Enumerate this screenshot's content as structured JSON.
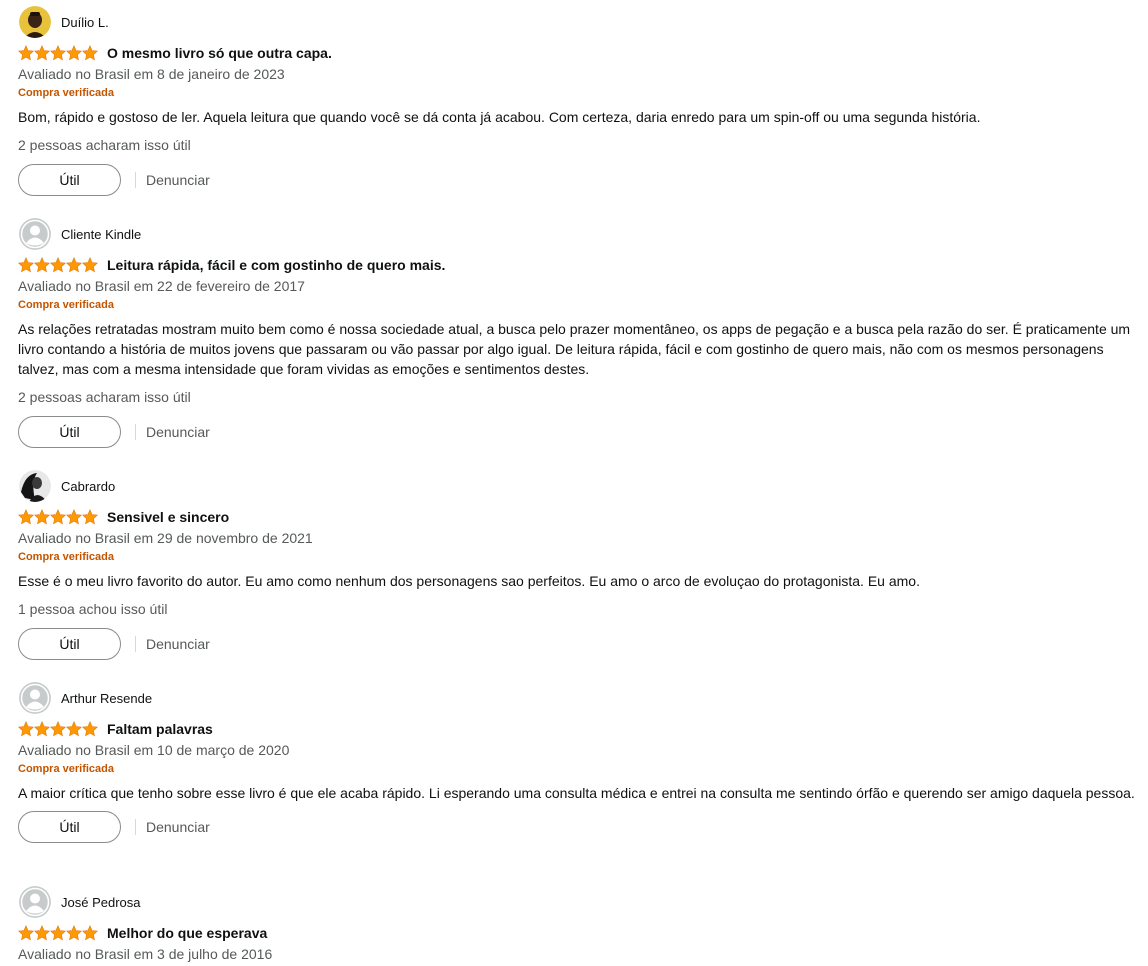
{
  "reviews": [
    {
      "reviewer": "Duílio L.",
      "avatar_icon": "user-photo-avatar",
      "rating": 5,
      "title": "O mesmo livro só que outra capa.",
      "date": "Avaliado no Brasil em 8 de janeiro de 2023",
      "verified": "Compra verificada",
      "body": "Bom, rápido e gostoso de ler. Aquela leitura que quando você se dá conta já acabou. Com certeza, daria enredo para um spin-off ou uma segunda história.",
      "helpful": "2 pessoas acharam isso útil",
      "useful_label": "Útil",
      "report_label": "Denunciar"
    },
    {
      "reviewer": "Cliente Kindle",
      "avatar_icon": "default-user-avatar",
      "rating": 5,
      "title": "Leitura rápida, fácil e com gostinho de quero mais.",
      "date": "Avaliado no Brasil em 22 de fevereiro de 2017",
      "verified": "Compra verificada",
      "body": "As relações retratadas mostram muito bem como é nossa sociedade atual, a busca pelo prazer momentâneo, os apps de pegação e a busca pela razão do ser. É praticamente um livro contando a história de muitos jovens que passaram ou vão passar por algo igual. De leitura rápida, fácil e com gostinho de quero mais, não com os mesmos personagens talvez, mas com a mesma intensidade que foram vividas as emoções e sentimentos destes.",
      "helpful": "2 pessoas acharam isso útil",
      "useful_label": "Útil",
      "report_label": "Denunciar"
    },
    {
      "reviewer": "Cabrardo",
      "avatar_icon": "user-photo-avatar",
      "rating": 5,
      "title": "Sensivel e sincero",
      "date": "Avaliado no Brasil em 29 de novembro de 2021",
      "verified": "Compra verificada",
      "body": "Esse é o meu livro favorito do autor. Eu amo como nenhum dos personagens sao perfeitos. Eu amo o arco de evoluçao do protagonista. Eu amo.",
      "helpful": "1 pessoa achou isso útil",
      "useful_label": "Útil",
      "report_label": "Denunciar"
    },
    {
      "reviewer": "Arthur Resende",
      "avatar_icon": "default-user-avatar",
      "rating": 5,
      "title": "Faltam palavras",
      "date": "Avaliado no Brasil em 10 de março de 2020",
      "verified": "Compra verificada",
      "body": "A maior crítica que tenho sobre esse livro é que ele acaba rápido. Li esperando uma consulta médica e entrei na consulta me sentindo órfão e querendo ser amigo daquela pessoa.",
      "useful_label": "Útil",
      "report_label": "Denunciar"
    },
    {
      "reviewer": "José Pedrosa",
      "avatar_icon": "default-user-avatar",
      "rating": 5,
      "title": "Melhor do que esperava",
      "date": "Avaliado no Brasil em 3 de julho de 2016"
    }
  ],
  "colors": {
    "star": "#ff9900",
    "star_outline": "#e47911",
    "verified": "#c45500",
    "muted_text": "#565959"
  }
}
